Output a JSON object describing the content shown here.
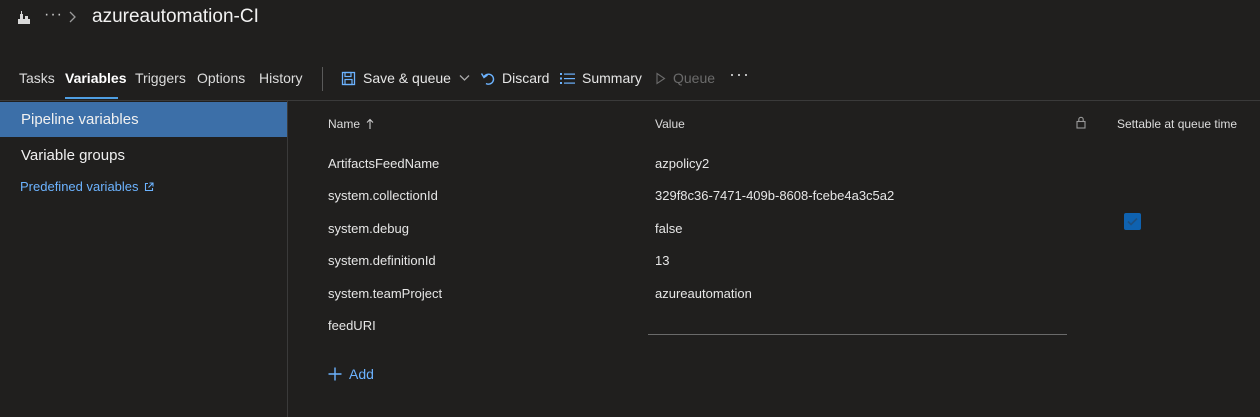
{
  "header": {
    "title": "azureautomation-CI",
    "icons": {
      "pipeline": "pipeline-icon",
      "more": "ellipsis-icon",
      "chevron": "chevron-right-icon"
    }
  },
  "tabs": [
    {
      "label": "Tasks"
    },
    {
      "label": "Variables",
      "active": true
    },
    {
      "label": "Triggers"
    },
    {
      "label": "Options"
    },
    {
      "label": "History"
    }
  ],
  "toolbar": {
    "save_queue": "Save & queue",
    "discard": "Discard",
    "summary": "Summary",
    "queue": "Queue"
  },
  "sidebar": {
    "items": [
      {
        "label": "Pipeline variables",
        "selected": true
      },
      {
        "label": "Variable groups"
      }
    ],
    "link": "Predefined variables"
  },
  "table": {
    "headers": {
      "name": "Name",
      "value": "Value",
      "settable": "Settable at queue time"
    },
    "rows": [
      {
        "name": "ArtifactsFeedName",
        "value": "azpolicy2",
        "settable": false
      },
      {
        "name": "system.collectionId",
        "value": "329f8c36-7471-409b-8608-fcebe4a3c5a2",
        "settable": false
      },
      {
        "name": "system.debug",
        "value": "false",
        "settable": true
      },
      {
        "name": "system.definitionId",
        "value": "13",
        "settable": false
      },
      {
        "name": "system.teamProject",
        "value": "azureautomation",
        "settable": false
      },
      {
        "name": "feedURI",
        "value": "",
        "settable": false
      }
    ],
    "add_label": "Add"
  },
  "colors": {
    "background": "#201f1e",
    "accent": "#3c6fa8",
    "link": "#6cb3ff",
    "checkbox": "#0f62b0"
  }
}
